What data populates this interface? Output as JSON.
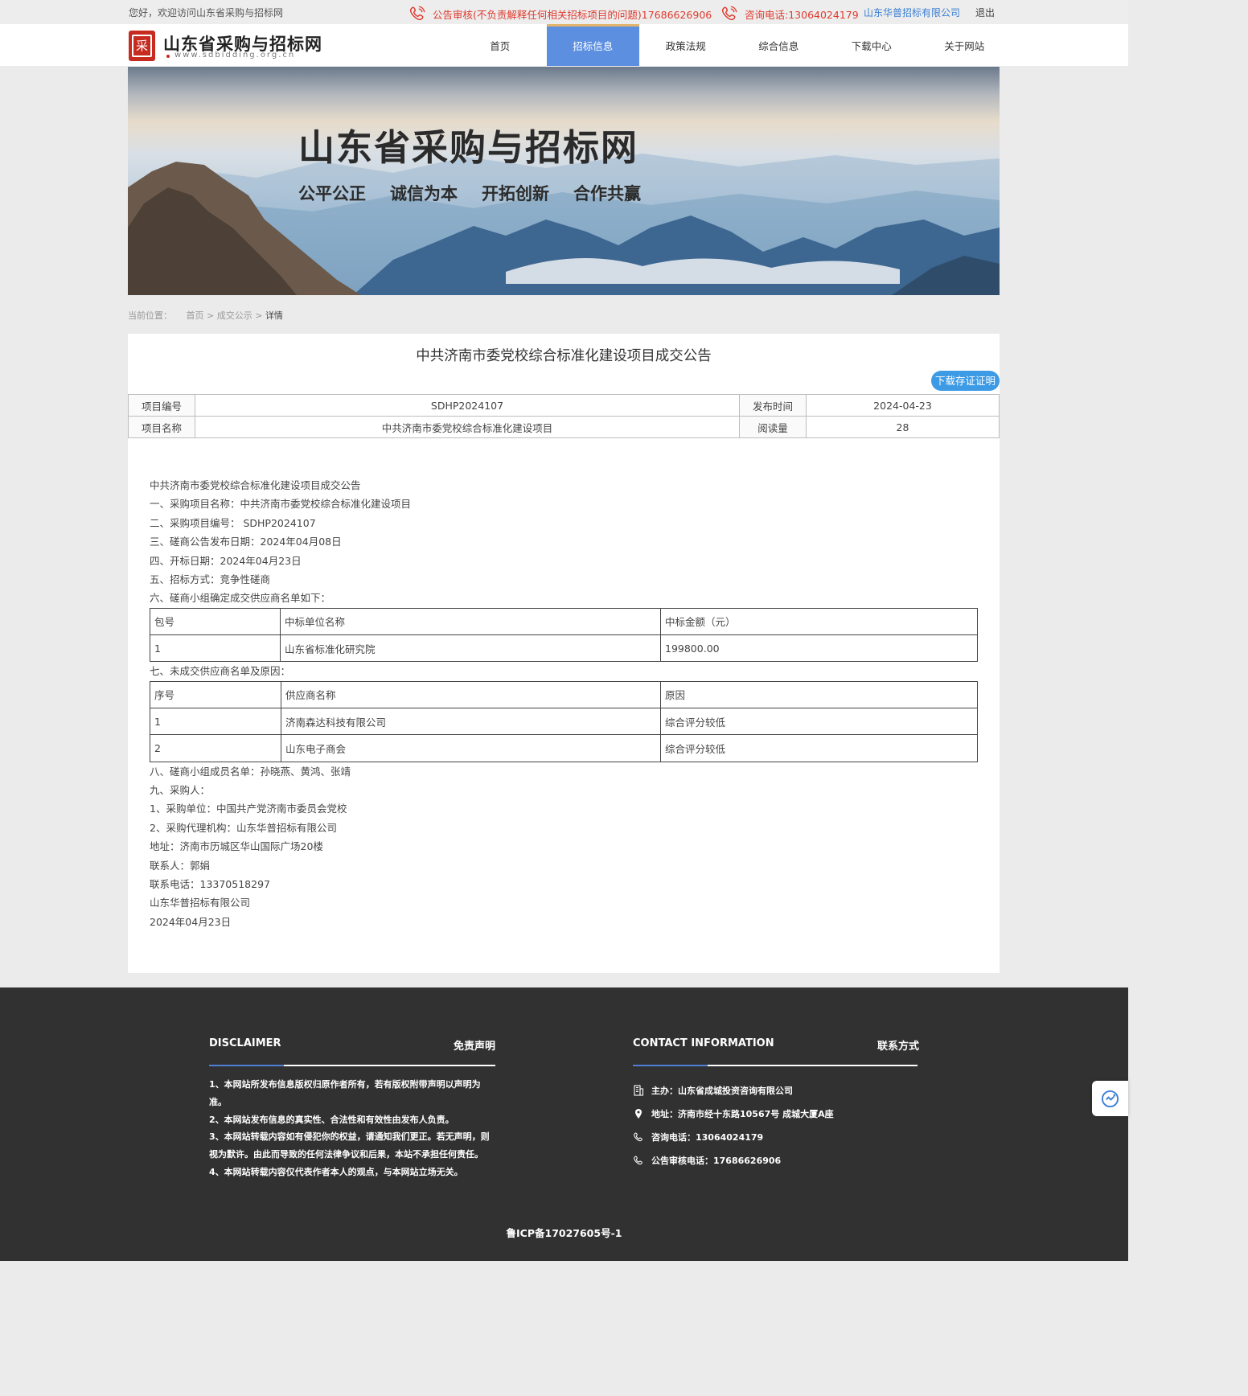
{
  "topbar": {
    "welcome": "您好，欢迎访问山东省采购与招标网",
    "notice": "公告审核(不负责解释任何相关招标项目的问题)17686626906",
    "consult_phone": "咨询电话:13064024179",
    "company": "山东华普招标有限公司",
    "logout": "退出",
    "icons": [
      "phone-icon",
      "phone-icon"
    ]
  },
  "logo": {
    "mark": "采",
    "title": "山东省采购与招标网",
    "url": "www.sdbidding.org.cn"
  },
  "nav": {
    "items": [
      "首页",
      "招标信息",
      "政策法规",
      "综合信息",
      "下载中心",
      "关于网站"
    ],
    "active": "招标信息",
    "active_color": "#5c8fe0"
  },
  "banner": {
    "title": "山东省采购与招标网",
    "slogans": [
      "公平公正",
      "诚信为本",
      "开拓创新",
      "合作共赢"
    ]
  },
  "breadcrumb": {
    "label": "当前位置：",
    "items": [
      "首页",
      "成交公示",
      "详情"
    ],
    "separator": ">"
  },
  "document": {
    "title": "中共济南市委党校综合标准化建设项目成交公告",
    "download_button": "下载存证证明",
    "meta": {
      "project_no_label": "项目编号",
      "project_no": "SDHP2024107",
      "publish_time_label": "发布时间",
      "publish_time": "2024-04-23",
      "project_name_label": "项目名称",
      "project_name": "中共济南市委党校综合标准化建设项目",
      "views_label": "阅读量",
      "views": "28"
    },
    "lines_before": [
      "中共济南市委党校综合标准化建设项目成交公告",
      "一、采购项目名称：中共济南市委党校综合标准化建设项目",
      "二、采购项目编号： SDHP2024107",
      "三、磋商公告发布日期：2024年04月08日",
      "四、开标日期：2024年04月23日",
      "五、招标方式：竞争性磋商",
      "六、磋商小组确定成交供应商名单如下："
    ],
    "winner_table": {
      "headers": [
        "包号",
        "中标单位名称",
        "中标金额（元）"
      ],
      "rows": [
        [
          "1",
          "山东省标准化研究院",
          "199800.00"
        ]
      ]
    },
    "line_mid": "七、未成交供应商名单及原因：",
    "loser_table": {
      "headers": [
        "序号",
        "供应商名称",
        "原因"
      ],
      "rows": [
        [
          "1",
          "济南森达科技有限公司",
          "综合评分较低"
        ],
        [
          "2",
          "山东电子商会",
          "综合评分较低"
        ]
      ]
    },
    "lines_after": [
      "八、磋商小组成员名单：孙晓燕、黄鸿、张靖",
      "九、采购人：",
      "1、采购单位：中国共产党济南市委员会党校",
      "2、采购代理机构：山东华普招标有限公司",
      "地址：济南市历城区华山国际广场20楼",
      "联系人：郭娟",
      "联系电话：13370518297",
      "山东华普招标有限公司",
      "2024年04月23日"
    ]
  },
  "footer": {
    "disclaimer_en": "DISCLAIMER",
    "disclaimer_cn": "免责声明",
    "disclaimer_items": [
      "1、本网站所发布信息版权归原作者所有，若有版权附带声明以声明为准。",
      "2、本网站发布信息的真实性、合法性和有效性由发布人负责。",
      "3、本网站转载内容如有侵犯你的权益，请通知我们更正。若无声明，则视为默许。由此而导致的任何法律争议和后果，本站不承担任何责任。",
      "4、本网站转载内容仅代表作者本人的观点，与本网站立场无关。"
    ],
    "contact_en": "CONTACT INFORMATION",
    "contact_cn": "联系方式",
    "contact_items": [
      {
        "icon": "building-icon",
        "text": "主办：山东省成城投资咨询有限公司"
      },
      {
        "icon": "location-pin-icon",
        "text": "地址：济南市经十东路10567号 成城大厦A座"
      },
      {
        "icon": "phone-icon",
        "text": "咨询电话：13064024179"
      },
      {
        "icon": "phone-icon",
        "text": "公告审核电话：17686626906"
      }
    ],
    "icp": "鲁ICP备17027605号-1",
    "accent_color": "#4f7fd6"
  },
  "float_widget": {
    "icon": "refresh-icon"
  }
}
